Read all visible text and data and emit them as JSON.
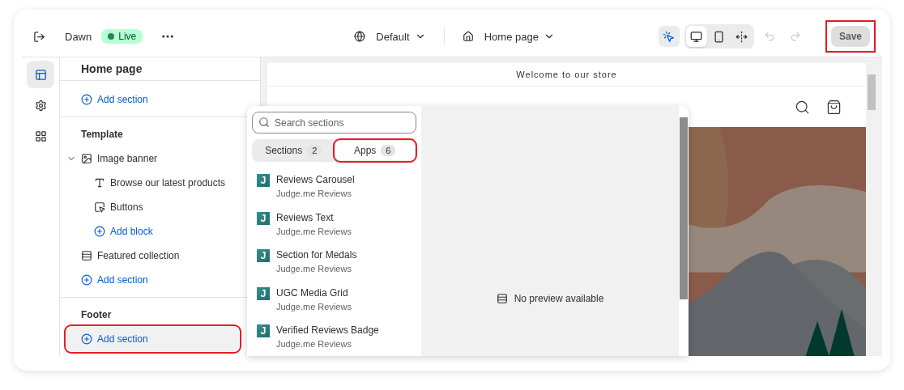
{
  "topbar": {
    "theme_name": "Dawn",
    "status": "Live",
    "template_picker": "Default",
    "page_picker": "Home page",
    "inspector_selected": true,
    "views": [
      {
        "kind": "desktop",
        "selected": true
      },
      {
        "kind": "mobile",
        "selected": false
      },
      {
        "kind": "fullwidth",
        "selected": false
      }
    ],
    "save": {
      "label": "Save",
      "disabled": true,
      "highlighted": true
    }
  },
  "rail": [
    {
      "kind": "sections",
      "selected": true
    },
    {
      "kind": "settings",
      "selected": false
    },
    {
      "kind": "apps",
      "selected": false
    }
  ],
  "sidebar": {
    "title": "Home page",
    "groups": [
      {
        "items": [
          {
            "kind": "add",
            "label": "Add section",
            "highlighted": false
          }
        ]
      },
      {
        "title": "Template",
        "items": [
          {
            "kind": "banner",
            "label": "Image banner",
            "expanded": true,
            "children": [
              {
                "kind": "text",
                "label": "Browse our latest products"
              },
              {
                "kind": "buttons",
                "label": "Buttons"
              },
              {
                "kind": "add",
                "label": "Add block"
              }
            ]
          },
          {
            "kind": "section",
            "label": "Featured collection"
          },
          {
            "kind": "add",
            "label": "Add section",
            "highlighted": false
          }
        ]
      },
      {
        "title": "Footer",
        "items": [
          {
            "kind": "add",
            "label": "Add section",
            "highlighted": true
          }
        ]
      }
    ]
  },
  "preview": {
    "announcement": "Welcome to our store"
  },
  "picker": {
    "search_placeholder": "Search sections",
    "tabs": [
      {
        "label": "Sections",
        "count": "2",
        "selected": false,
        "highlighted": false
      },
      {
        "label": "Apps",
        "count": "6",
        "selected": true,
        "highlighted": true
      }
    ],
    "items": [
      {
        "logo": "J",
        "title": "Reviews Carousel",
        "app": "Judge.me Reviews"
      },
      {
        "logo": "J",
        "title": "Reviews Text",
        "app": "Judge.me Reviews"
      },
      {
        "logo": "J",
        "title": "Section for Medals",
        "app": "Judge.me Reviews"
      },
      {
        "logo": "J",
        "title": "UGC Media Grid",
        "app": "Judge.me Reviews"
      },
      {
        "logo": "J",
        "title": "Verified Reviews Badge",
        "app": "Judge.me Reviews"
      }
    ],
    "empty_preview": "No preview available"
  }
}
